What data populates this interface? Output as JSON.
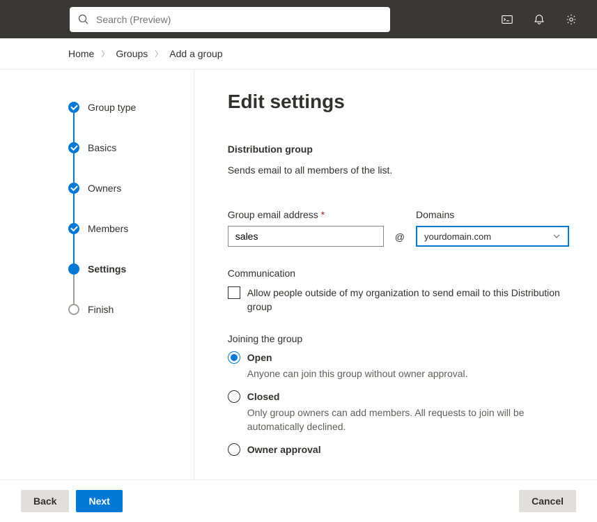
{
  "header": {
    "searchPlaceholder": "Search (Preview)"
  },
  "breadcrumb": {
    "items": [
      "Home",
      "Groups",
      "Add a group"
    ]
  },
  "steps": [
    {
      "label": "Group type",
      "state": "completed"
    },
    {
      "label": "Basics",
      "state": "completed"
    },
    {
      "label": "Owners",
      "state": "completed"
    },
    {
      "label": "Members",
      "state": "completed"
    },
    {
      "label": "Settings",
      "state": "current"
    },
    {
      "label": "Finish",
      "state": "pending"
    }
  ],
  "main": {
    "title": "Edit settings",
    "subtitle": "Distribution group",
    "desc": "Sends email to all members of the list.",
    "emailLabel": "Group email address",
    "emailValue": "sales",
    "atSymbol": "@",
    "domainLabel": "Domains",
    "domainValue": "yourdomain.com",
    "commTitle": "Communication",
    "commCheckbox": "Allow people outside of my organization to send email to this Distribution group",
    "joinTitle": "Joining the group",
    "joinOptions": [
      {
        "label": "Open",
        "desc": "Anyone can join this group without owner approval.",
        "checked": true
      },
      {
        "label": "Closed",
        "desc": "Only group owners can add members. All requests to join will be automatically declined.",
        "checked": false
      },
      {
        "label": "Owner approval",
        "desc": "",
        "checked": false
      }
    ]
  },
  "footer": {
    "back": "Back",
    "next": "Next",
    "cancel": "Cancel"
  }
}
